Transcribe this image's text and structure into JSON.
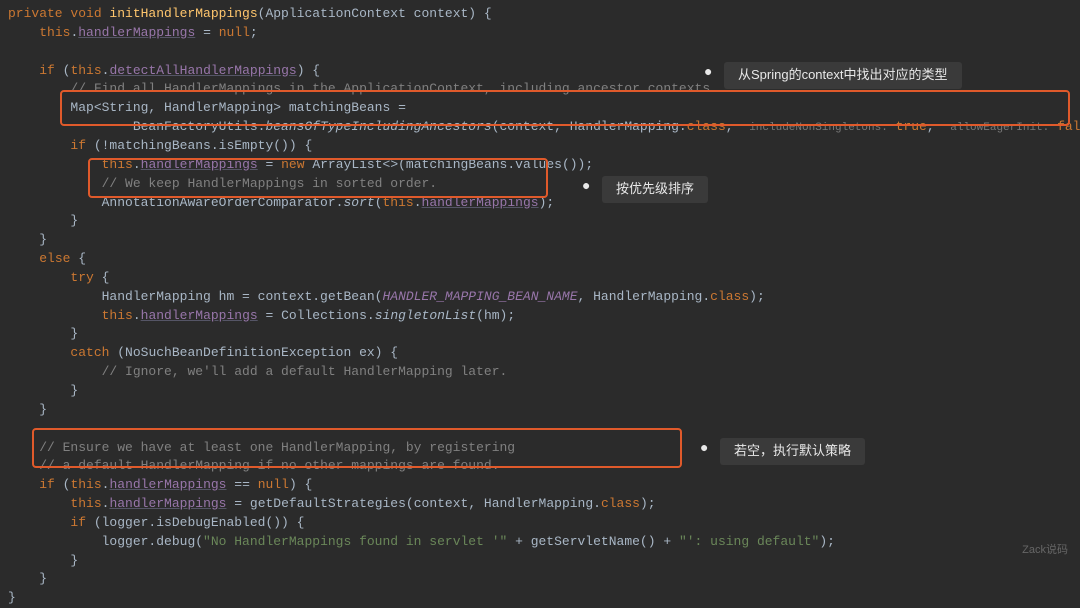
{
  "code": {
    "l1": {
      "kw1": "private void ",
      "m": "initHandlerMappings",
      "rest": "(ApplicationContext context) {"
    },
    "l2": {
      "kw": "this",
      "dot": ".",
      "f": "handlerMappings",
      "rest": " = ",
      "kw2": "null",
      "semi": ";"
    },
    "l3": {
      "kw1": "if ",
      "p1": "(",
      "kw2": "this",
      "dot": ".",
      "f": "detectAllHandlerMappings",
      "rest": ") {"
    },
    "l4": {
      "c": "// Find all HandlerMappings in the ApplicationContext, including ancestor contexts."
    },
    "l5": {
      "t": "Map<String, HandlerMapping> matchingBeans ="
    },
    "l6": {
      "t1": "BeanFactoryUtils.",
      "m": "beansOfTypeIncludingAncestors",
      "t2": "(context, HandlerMapping.",
      "kw": "class",
      "comma": ", ",
      "h1": "includeNonSingletons:",
      "v1": " true",
      "comma2": ", ",
      "h2": "allowEagerInit:",
      "v2": " false",
      "end": ");"
    },
    "l7": {
      "kw": "if ",
      "t": "(!matchingBeans.isEmpty()) {"
    },
    "l8": {
      "kw1": "this",
      "dot": ".",
      "f": "handlerMappings",
      "eq": " = ",
      "kw2": "new ",
      "t": "ArrayList<>(matchingBeans.values());"
    },
    "l9": {
      "c": "// We keep HandlerMappings in sorted order."
    },
    "l10": {
      "t1": "AnnotationAwareOrderComparator.",
      "m": "sort",
      "t2": "(",
      "kw": "this",
      "dot": ".",
      "f": "handlerMappings",
      "end": ");"
    },
    "l11": {
      "t": "}"
    },
    "l12": {
      "t": "}"
    },
    "l13": {
      "kw": "else ",
      "t": "{"
    },
    "l14": {
      "kw": "try ",
      "t": "{"
    },
    "l15": {
      "t1": "HandlerMapping hm = context.getBean(",
      "m": "HANDLER_MAPPING_BEAN_NAME",
      "t2": ", HandlerMapping.",
      "kw": "class",
      "end": ");"
    },
    "l16": {
      "kw1": "this",
      "dot": ".",
      "f": "handlerMappings",
      "eq": " = Collections.",
      "m": "singletonList",
      "end": "(hm);"
    },
    "l17": {
      "t": "}"
    },
    "l18": {
      "kw": "catch ",
      "t": "(NoSuchBeanDefinitionException ex) {"
    },
    "l19": {
      "c": "// Ignore, we'll add a default HandlerMapping later."
    },
    "l20": {
      "t": "}"
    },
    "l21": {
      "t": "}"
    },
    "l22": {
      "c": "// Ensure we have at least one HandlerMapping, by registering"
    },
    "l23": {
      "c": "// a default HandlerMapping if no other mappings are found."
    },
    "l24": {
      "kw1": "if ",
      "p1": "(",
      "kw2": "this",
      "dot": ".",
      "f": "handlerMappings",
      "eq": " == ",
      "kw3": "null",
      "end": ") {"
    },
    "l25": {
      "kw1": "this",
      "dot": ".",
      "f": "handlerMappings",
      "eq": " = getDefaultStrategies(context, HandlerMapping.",
      "kw2": "class",
      "end": ");"
    },
    "l26": {
      "kw": "if ",
      "t": "(logger.isDebugEnabled()) {"
    },
    "l27": {
      "t1": "logger.debug(",
      "s": "\"No HandlerMappings found in servlet '\"",
      "t2": " + getServletName() + ",
      "s2": "\"': using default\"",
      "end": ");"
    },
    "l28": {
      "t": "}"
    },
    "l29": {
      "t": "}"
    },
    "l30": {
      "t": "}"
    }
  },
  "annotations": {
    "a1": "从Spring的context中找出对应的类型",
    "a2": "按优先级排序",
    "a3": "若空，执行默认策略"
  },
  "watermark": "Zack说码"
}
